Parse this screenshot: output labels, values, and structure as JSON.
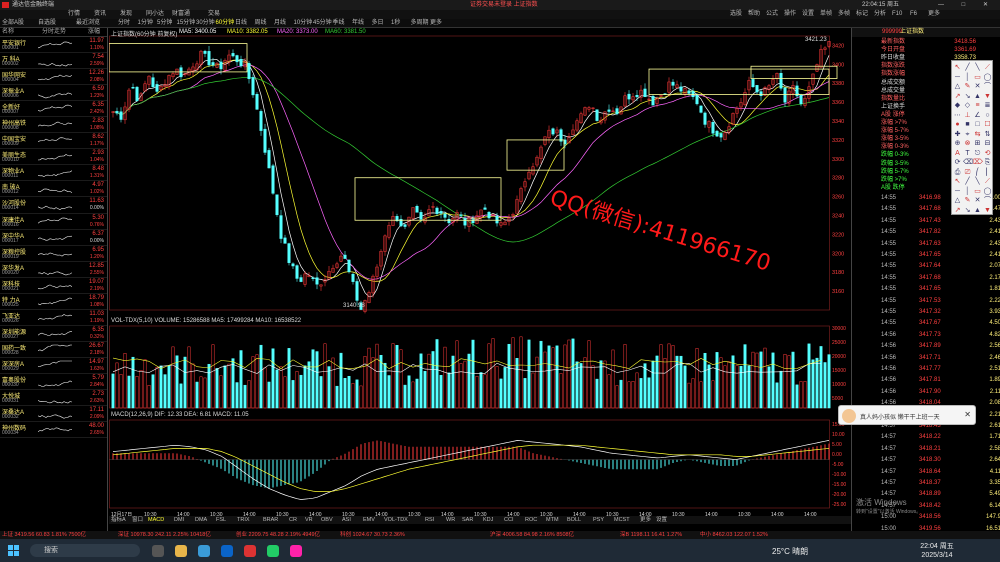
{
  "window": {
    "app_name": "通达信金融终端",
    "notice": "证券交易未登录 上证指数",
    "clock": "22:04:15 周五",
    "controls": "— □ ✕"
  },
  "menus": [
    "行情",
    "资讯",
    "发现",
    "同小达",
    "财富通",
    "交易",
    "选股",
    "帮助",
    "公式",
    "操作",
    "设置",
    "单帧",
    "多帧",
    "标记",
    "分析",
    "F10",
    "F6",
    "更多"
  ],
  "toolbar": {
    "left": [
      "全部A股",
      "自选股",
      "最近浏览"
    ],
    "periods": [
      "分时",
      "1分钟",
      "5分钟",
      "15分钟",
      "30分钟",
      "60分钟",
      "日线",
      "周线",
      "月线",
      "10分钟",
      "45分钟",
      "季线",
      "年线",
      "多日",
      "1秒",
      "多周期",
      "更多"
    ],
    "active_period": "60分钟"
  },
  "sidebar": {
    "headers": [
      "名称",
      "分时走势",
      "涨幅"
    ],
    "stocks": [
      {
        "name": "平安银行",
        "code": "000001",
        "price": "11.97",
        "pct": "1.10%"
      },
      {
        "name": "万 科A",
        "code": "000002",
        "price": "7.54",
        "pct": "2.59%"
      },
      {
        "name": "国华网安",
        "code": "000004",
        "price": "12.26",
        "pct": "2.08%"
      },
      {
        "name": "深振业A",
        "code": "000006",
        "price": "6.59",
        "pct": "1.23%"
      },
      {
        "name": "全新好",
        "code": "000007",
        "price": "6.35",
        "pct": "2.42%"
      },
      {
        "name": "神州高铁",
        "code": "000008",
        "price": "2.83",
        "pct": "1.08%"
      },
      {
        "name": "中国宝安",
        "code": "000009",
        "price": "8.62",
        "pct": "1.17%"
      },
      {
        "name": "美丽生态",
        "code": "000010",
        "price": "2.93",
        "pct": "1.04%"
      },
      {
        "name": "深物业A",
        "code": "000011",
        "price": "8.48",
        "pct": "1.31%"
      },
      {
        "name": "南 玻A",
        "code": "000012",
        "price": "4.97",
        "pct": "1.02%"
      },
      {
        "name": "沙河股份",
        "code": "000014",
        "price": "11.63",
        "pct": "0.00%"
      },
      {
        "name": "深康佳A",
        "code": "000016",
        "price": "5.30",
        "pct": "0.76%"
      },
      {
        "name": "深中华A",
        "code": "000017",
        "price": "6.37",
        "pct": "0.00%"
      },
      {
        "name": "深粮控股",
        "code": "000019",
        "price": "6.95",
        "pct": "1.20%"
      },
      {
        "name": "深华发A",
        "code": "000020",
        "price": "12.85",
        "pct": "2.55%"
      },
      {
        "name": "深科技",
        "code": "000021",
        "price": "19.07",
        "pct": "2.19%"
      },
      {
        "name": "特 力A",
        "code": "000025",
        "price": "18.79",
        "pct": "1.08%"
      },
      {
        "name": "飞亚达",
        "code": "000026",
        "price": "11.03",
        "pct": "1.19%"
      },
      {
        "name": "深圳能源",
        "code": "000027",
        "price": "6.35",
        "pct": "0.32%"
      },
      {
        "name": "国药一致",
        "code": "000028",
        "price": "26.67",
        "pct": "2.18%"
      },
      {
        "name": "深深房A",
        "code": "000029",
        "price": "14.97",
        "pct": "1.63%"
      },
      {
        "name": "富奥股份",
        "code": "000030",
        "price": "5.79",
        "pct": "2.84%"
      },
      {
        "name": "大悦城",
        "code": "000031",
        "price": "2.73",
        "pct": "2.63%"
      },
      {
        "name": "深桑达A",
        "code": "000032",
        "price": "17.11",
        "pct": "2.09%"
      },
      {
        "name": "神州数码",
        "code": "000034",
        "price": "48.00",
        "pct": "2.65%"
      }
    ]
  },
  "chart_titles": {
    "main": "上证指数(60分钟 前复权)",
    "ma_labels": [
      "MA5: 3400.05",
      "MA10: 3382.05",
      "MA20: 3373.00",
      "MA60: 3381.50"
    ],
    "volume": "VOL-TDX(5,10) VOLUME: 15286588  MA5: 17499284  MA10: 16538522",
    "macd": "MACD(12,26,9) DIF: 12.33  DEA: 6.81  MACD: 11.05"
  },
  "chart_annotations": {
    "high_label": "3421.23",
    "low_label": "3140.98",
    "watermark": "QQ(微信):411966170"
  },
  "axis": {
    "price_ticks": [
      "3420",
      "3400",
      "3380",
      "3360",
      "3340",
      "3320",
      "3300",
      "3280",
      "3260",
      "3240",
      "3220",
      "3200",
      "3180",
      "3160"
    ],
    "volume_ticks": [
      "30000",
      "25000",
      "20000",
      "15000",
      "10000",
      "5000"
    ],
    "macd_ticks": [
      "15.00",
      "10.00",
      "5.00",
      "0.00",
      "-5.00",
      "-10.00",
      "-15.00",
      "-20.00",
      "-25.00"
    ],
    "time_ticks": [
      "12月17日",
      "10:30",
      "14:00",
      "10:30",
      "14:00",
      "10:30",
      "14:00",
      "10:30",
      "14:00",
      "10:30",
      "14:00",
      "10:30",
      "14:00",
      "10:30",
      "14:00",
      "10:30",
      "14:00",
      "10:30",
      "14:00",
      "10:30",
      "14:00",
      "14:00"
    ]
  },
  "indicator_tabs": [
    "指标A",
    "窗口",
    "MACD",
    "DMI",
    "DMA",
    "FSL",
    "TRIX",
    "BRAR",
    "CR",
    "VR",
    "OBV",
    "ASI",
    "EMV",
    "VOL-TDX",
    "RSI",
    "WR",
    "SAR",
    "KDJ",
    "CCI",
    "ROC",
    "MTM",
    "BOLL",
    "PSY",
    "MCST",
    "更多",
    "设置"
  ],
  "active_indicator_tab": "MACD",
  "right_panel": {
    "index_code": "999999",
    "index_name": "上证指数",
    "stats": [
      {
        "label": "最新指数",
        "value": "3418.56",
        "color": "red"
      },
      {
        "label": "今日开盘",
        "value": "3361.69",
        "color": "red"
      },
      {
        "label": "昨日收盘",
        "value": "3358.73",
        "color": "yellow"
      },
      {
        "label": "指数涨跌",
        "value": "59.83",
        "color": "red"
      },
      {
        "label": "指数涨幅",
        "value": "1.78%",
        "color": "red"
      },
      {
        "label": "总成交额",
        "value": "6019亿",
        "color": "yellow"
      },
      {
        "label": "总成交量",
        "value": "4.70亿",
        "color": "yellow"
      },
      {
        "label": "指数量比",
        "value": "1.05",
        "color": "red"
      },
      {
        "label": "上证换手",
        "value": "1.08%",
        "color": "yellow"
      },
      {
        "label": "A股 涨停",
        "value": "",
        "color": "red"
      },
      {
        "label": "涨幅 >7%",
        "value": "",
        "color": "red"
      },
      {
        "label": "涨幅 5-7%",
        "value": "",
        "color": "red"
      },
      {
        "label": "涨幅 3-5%",
        "value": "",
        "color": "red"
      },
      {
        "label": "涨幅 0-3%",
        "value": "",
        "color": "red"
      },
      {
        "label": "跌幅 0-3%",
        "value": "",
        "color": "green"
      },
      {
        "label": "跌幅 3-5%",
        "value": "",
        "color": "green"
      },
      {
        "label": "跌幅 5-7%",
        "value": "",
        "color": "green"
      },
      {
        "label": "跌幅 >7%",
        "value": "",
        "color": "green"
      },
      {
        "label": "A股 跌停",
        "value": "",
        "color": "green"
      }
    ],
    "trades": [
      {
        "time": "14:55",
        "price": "3416.98",
        "vol": "0.00"
      },
      {
        "time": "14:55",
        "price": "3417.68",
        "vol": "2.47"
      },
      {
        "time": "14:55",
        "price": "3417.43",
        "vol": "2.43"
      },
      {
        "time": "14:55",
        "price": "3417.82",
        "vol": "2.41"
      },
      {
        "time": "14:55",
        "price": "3417.63",
        "vol": "2.43"
      },
      {
        "time": "14:55",
        "price": "3417.65",
        "vol": "2.41"
      },
      {
        "time": "14:55",
        "price": "3417.64",
        "vol": "2.07"
      },
      {
        "time": "14:55",
        "price": "3417.68",
        "vol": "2.17"
      },
      {
        "time": "14:55",
        "price": "3417.65",
        "vol": "1.81"
      },
      {
        "time": "14:55",
        "price": "3417.53",
        "vol": "2.22"
      },
      {
        "time": "14:55",
        "price": "3417.32",
        "vol": "3.93"
      },
      {
        "time": "14:55",
        "price": "3417.67",
        "vol": "4.50"
      },
      {
        "time": "14:56",
        "price": "3417.73",
        "vol": "4.82"
      },
      {
        "time": "14:56",
        "price": "3417.89",
        "vol": "2.56"
      },
      {
        "time": "14:56",
        "price": "3417.71",
        "vol": "2.46"
      },
      {
        "time": "14:56",
        "price": "3417.77",
        "vol": "2.51"
      },
      {
        "time": "14:56",
        "price": "3417.81",
        "vol": "1.89"
      },
      {
        "time": "14:56",
        "price": "3417.90",
        "vol": "2.11"
      },
      {
        "time": "14:56",
        "price": "3418.04",
        "vol": "2.08"
      },
      {
        "time": "14:56",
        "price": "3418.19",
        "vol": "2.21"
      },
      {
        "time": "14:57",
        "price": "3418.43",
        "vol": "2.61"
      },
      {
        "time": "14:57",
        "price": "3418.22",
        "vol": "1.71"
      },
      {
        "time": "14:57",
        "price": "3418.21",
        "vol": "2.58"
      },
      {
        "time": "14:57",
        "price": "3418.30",
        "vol": "2.64"
      },
      {
        "time": "14:57",
        "price": "3418.64",
        "vol": "4.11"
      },
      {
        "time": "14:57",
        "price": "3418.37",
        "vol": "3.35"
      },
      {
        "time": "14:57",
        "price": "3418.89",
        "vol": "5.49"
      },
      {
        "time": "14:57",
        "price": "3418.42",
        "vol": "6.14"
      },
      {
        "time": "15:00",
        "price": "3418.56",
        "vol": "147.9"
      },
      {
        "time": "15:00",
        "price": "3419.56",
        "vol": "16.51"
      }
    ]
  },
  "popup": {
    "text": "真人妈小孩似  懒干干上班一天",
    "close": "✕"
  },
  "windows_activate": {
    "line1": "激活 Windows",
    "line2": "转到\"设置\"以激活 Windows。"
  },
  "status_bar": [
    "上证 3419.56 60.83 1.81% 7500亿",
    "深证 10978.30 242.11 2.25% 10418亿",
    "创业 2209.75 48.28 2.19% 4949亿",
    "科创 1024.67 30.73 2.36%",
    "沪深 4006.58 84.98 2.16% 8508亿",
    "深B 1198.11 16.41 1.27%",
    "中小 8462.03 122.07 1.52%"
  ],
  "taskbar": {
    "search_placeholder": "搜索",
    "weather": "25°C 晴朗",
    "time": "22:04 周五",
    "date": "2025/3/14"
  },
  "chart_data": {
    "type": "candlestick",
    "title": "上证指数(60分钟 前复权)",
    "ylim": [
      3140,
      3430
    ],
    "price_path": [
      3350,
      3345,
      3380,
      3360,
      3390,
      3368,
      3385,
      3395,
      3388,
      3400,
      3410,
      3402,
      3395,
      3410,
      3405,
      3398,
      3365,
      3320,
      3270,
      3220,
      3190,
      3170,
      3180,
      3165,
      3175,
      3190,
      3200,
      3170,
      3140,
      3160,
      3190,
      3230,
      3240,
      3225,
      3245,
      3230,
      3250,
      3245,
      3235,
      3242,
      3230,
      3240,
      3248,
      3236,
      3228,
      3240,
      3260,
      3290,
      3300,
      3325,
      3330,
      3318,
      3335,
      3345,
      3360,
      3340,
      3355,
      3350,
      3365,
      3370,
      3372,
      3360,
      3368,
      3380,
      3375,
      3368,
      3362,
      3340,
      3330,
      3325,
      3345,
      3360,
      3380,
      3370,
      3372,
      3390,
      3360,
      3375,
      3355,
      3380,
      3410,
      3421
    ],
    "macd_dif": [
      5,
      6,
      7,
      8,
      9,
      8,
      6,
      2,
      -5,
      -12,
      -18,
      -22,
      -25,
      -24,
      -20,
      -16,
      -10,
      -6,
      -4,
      -2,
      0,
      2,
      4,
      6,
      8,
      10,
      12,
      11,
      10,
      9,
      8,
      6,
      4,
      3,
      2,
      1,
      2,
      3,
      2,
      1,
      0,
      2,
      4,
      6,
      8,
      10,
      12
    ],
    "macd_dea": [
      3,
      4,
      5,
      6,
      7,
      7,
      7,
      5,
      1,
      -4,
      -9,
      -14,
      -18,
      -20,
      -20,
      -18,
      -15,
      -12,
      -9,
      -6,
      -4,
      -2,
      0,
      2,
      4,
      6,
      8,
      9,
      9,
      9,
      9,
      8,
      7,
      6,
      5,
      4,
      3,
      3,
      3,
      3,
      2,
      2,
      3,
      4,
      5,
      6,
      7
    ]
  },
  "colors": {
    "up": "#ff3a3a",
    "down": "#55ffff",
    "ma5": "#ffffff",
    "ma10": "#ffff33",
    "ma20": "#ff66ff",
    "ma60": "#33cc33",
    "box": "#ffff99"
  }
}
